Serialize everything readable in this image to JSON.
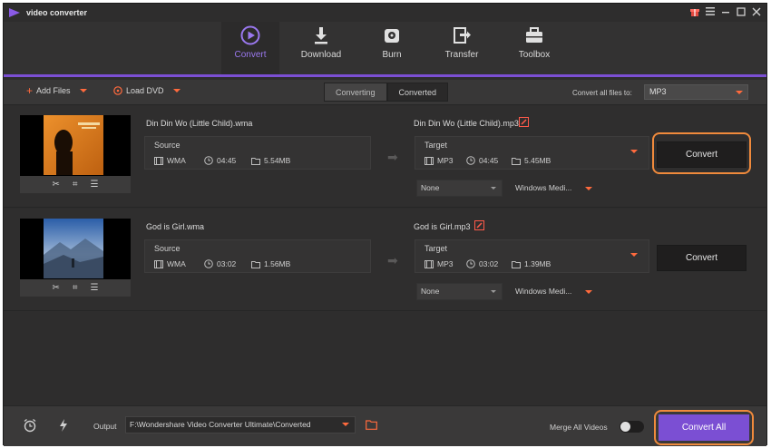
{
  "app": {
    "title": "video converter"
  },
  "window_controls": [
    "gift-icon",
    "menu-icon",
    "minimize-icon",
    "maximize-icon",
    "close-icon"
  ],
  "nav": {
    "items": [
      {
        "label": "Convert",
        "icon": "play-circle-icon",
        "active": true
      },
      {
        "label": "Download",
        "icon": "download-icon",
        "active": false
      },
      {
        "label": "Burn",
        "icon": "disc-icon",
        "active": false
      },
      {
        "label": "Transfer",
        "icon": "transfer-icon",
        "active": false
      },
      {
        "label": "Toolbox",
        "icon": "toolbox-icon",
        "active": false
      }
    ]
  },
  "toolbar": {
    "add_files": "Add Files",
    "load_dvd": "Load DVD",
    "tabs": [
      "Converting",
      "Converted"
    ],
    "convert_all_to_label": "Convert all files to:",
    "format": "MP3"
  },
  "files": [
    {
      "source_name": "Din Din Wo (Little Child).wma",
      "source_label": "Source",
      "source_format": "WMA",
      "source_duration": "04:45",
      "source_size": "5.54MB",
      "target_name": "Din Din Wo (Little Child).mp3",
      "target_label": "Target",
      "target_format": "MP3",
      "target_duration": "04:45",
      "target_size": "5.45MB",
      "subtitle": "None",
      "encoder": "Windows Medi...",
      "convert_label": "Convert",
      "highlighted": true
    },
    {
      "source_name": "God is Girl.wma",
      "source_label": "Source",
      "source_format": "WMA",
      "source_duration": "03:02",
      "source_size": "1.56MB",
      "target_name": "God is Girl.mp3",
      "target_label": "Target",
      "target_format": "MP3",
      "target_duration": "03:02",
      "target_size": "1.39MB",
      "subtitle": "None",
      "encoder": "Windows Medi...",
      "convert_label": "Convert",
      "highlighted": false
    }
  ],
  "bottom": {
    "output_label": "Output",
    "output_path": "F:\\Wondershare Video Converter Ultimate\\Converted",
    "merge_label": "Merge All Videos",
    "convert_all": "Convert All"
  },
  "colors": {
    "accent": "#7b4fd3",
    "highlight": "#f08a3c",
    "caret": "#ff6a3d"
  }
}
